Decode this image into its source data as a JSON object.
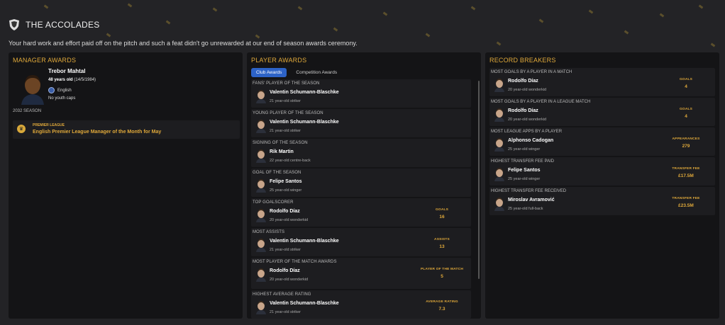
{
  "header": {
    "title": "THE ACCOLADES",
    "subtitle": "Your hard work and effort paid off on the pitch and such a feat didn't go unrewarded at our end of season awards ceremony."
  },
  "manager_awards": {
    "title": "MANAGER AWARDS",
    "name": "Trebor Mahtal",
    "age": "48 years old",
    "dob": "(14/5/1984)",
    "nationality": "English",
    "caps": "No youth caps",
    "season": "2032 SEASON",
    "award": {
      "competition": "PREMIER LEAGUE",
      "name": "English Premier League Manager of the Month for May"
    }
  },
  "player_awards": {
    "title": "PLAYER AWARDS",
    "tabs": [
      "Club Awards",
      "Competition Awards"
    ],
    "items": [
      {
        "category": "FANS' PLAYER OF THE SEASON",
        "player": "Valentin Schumann-Blaschke",
        "desc": "21 year-old striker",
        "stat_label": "",
        "stat_value": ""
      },
      {
        "category": "YOUNG PLAYER OF THE SEASON",
        "player": "Valentin Schumann-Blaschke",
        "desc": "21 year-old striker",
        "stat_label": "",
        "stat_value": ""
      },
      {
        "category": "SIGNING OF THE SEASON",
        "player": "Rik Martin",
        "desc": "22 year-old centre-back",
        "stat_label": "",
        "stat_value": ""
      },
      {
        "category": "GOAL OF THE SEASON",
        "player": "Felipe Santos",
        "desc": "25 year-old winger",
        "stat_label": "",
        "stat_value": ""
      },
      {
        "category": "TOP GOALSCORER",
        "player": "Rodolfo Díaz",
        "desc": "20 year-old wonderkid",
        "stat_label": "GOALS",
        "stat_value": "16"
      },
      {
        "category": "MOST ASSISTS",
        "player": "Valentin Schumann-Blaschke",
        "desc": "21 year-old striker",
        "stat_label": "ASSISTS",
        "stat_value": "13"
      },
      {
        "category": "MOST PLAYER OF THE MATCH AWARDS",
        "player": "Rodolfo Díaz",
        "desc": "20 year-old wonderkid",
        "stat_label": "PLAYER OF THE MATCH",
        "stat_value": "5"
      },
      {
        "category": "HIGHEST AVERAGE RATING",
        "player": "Valentin Schumann-Blaschke",
        "desc": "21 year-old striker",
        "stat_label": "AVERAGE RATING",
        "stat_value": "7.3"
      }
    ]
  },
  "record_breakers": {
    "title": "RECORD BREAKERS",
    "items": [
      {
        "category": "MOST GOALS BY A PLAYER IN A MATCH",
        "player": "Rodolfo Díaz",
        "desc": "20 year-old wonderkid",
        "stat_label": "GOALS",
        "stat_value": "4"
      },
      {
        "category": "MOST GOALS BY A PLAYER IN A LEAGUE MATCH",
        "player": "Rodolfo Díaz",
        "desc": "20 year-old wonderkid",
        "stat_label": "GOALS",
        "stat_value": "4"
      },
      {
        "category": "MOST LEAGUE APPS BY A PLAYER",
        "player": "Alphonso Cadogan",
        "desc": "25 year-old winger",
        "stat_label": "APPEARANCES",
        "stat_value": "279"
      },
      {
        "category": "HIGHEST TRANSFER FEE PAID",
        "player": "Felipe Santos",
        "desc": "25 year-old winger",
        "stat_label": "TRANSFER FEE",
        "stat_value": "£17.5M"
      },
      {
        "category": "HIGHEST TRANSFER FEE RECEIVED",
        "player": "Miroslav Avramović",
        "desc": "25 year-old full-back",
        "stat_label": "TRANSFER FEE",
        "stat_value": "£23.5M"
      }
    ]
  },
  "colors": {
    "accent": "#e0a93a",
    "tab_active": "#2d63c7",
    "panel": "#141416",
    "card": "#1d1d20"
  }
}
